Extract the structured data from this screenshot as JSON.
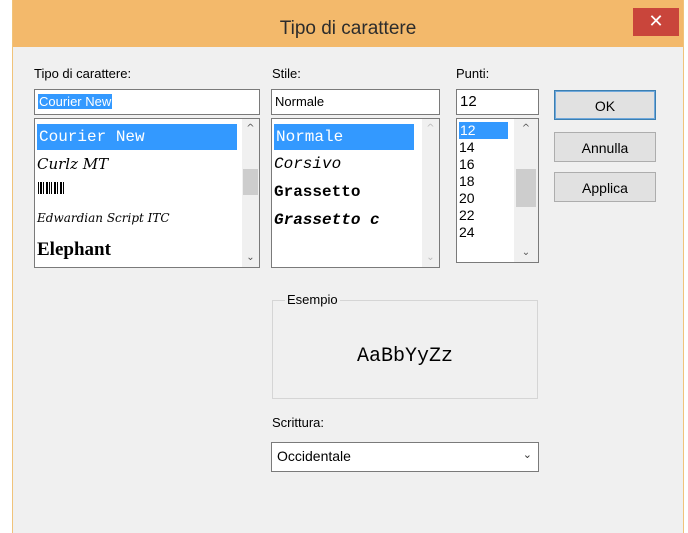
{
  "window": {
    "title": "Tipo di carattere",
    "close_glyph": "✕"
  },
  "font": {
    "label": "Tipo di carattere:",
    "value": "Courier New",
    "items": [
      "Courier New",
      "Curlz MT",
      "Free 3 of 9",
      "Edwardian Script ITC",
      "Elephant"
    ]
  },
  "style": {
    "label": "Stile:",
    "value": "Normale",
    "items": [
      "Normale",
      "Corsivo",
      "Grassetto",
      "Grassetto c"
    ]
  },
  "size": {
    "label": "Punti:",
    "value": "12",
    "items": [
      "12",
      "14",
      "16",
      "18",
      "20",
      "22",
      "24"
    ]
  },
  "buttons": {
    "ok": "OK",
    "cancel": "Annulla",
    "apply": "Applica"
  },
  "sample": {
    "label": "Esempio",
    "text": "AaBbYyZz"
  },
  "script": {
    "label": "Scrittura:",
    "value": "Occidentale"
  },
  "icons": {
    "scroll_up": "^",
    "scroll_down": "⌄",
    "combo_down": "⌄"
  }
}
